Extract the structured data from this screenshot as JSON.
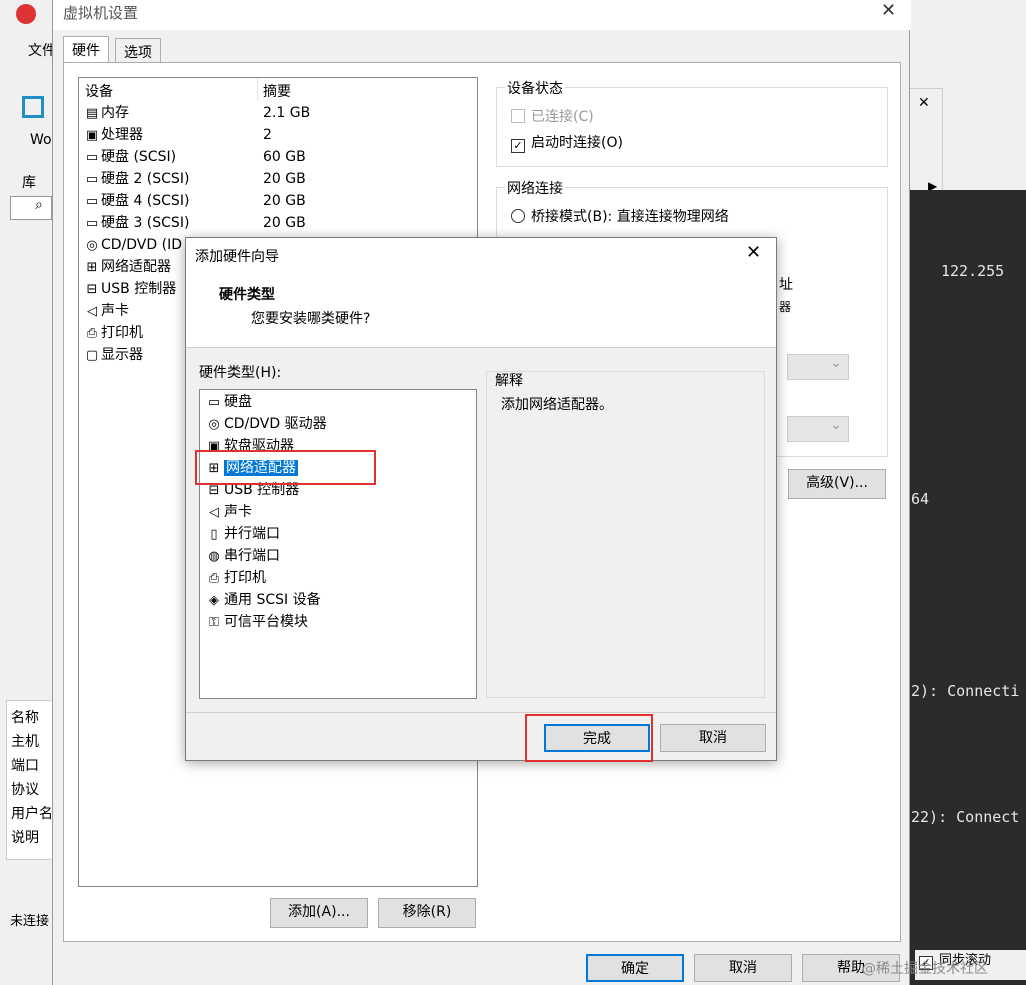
{
  "background": {
    "left_menu": [
      "文件",
      "库",
      "Wo"
    ],
    "left_fields": [
      "名称",
      "主机",
      "端口",
      "协议",
      "用户名",
      "说明"
    ],
    "status": "未连接",
    "terminal_lines": [
      "122.255",
      "64",
      "2): Connecti",
      "22): Connect"
    ],
    "sync_scroll": "同步滚动",
    "watermark": "@稀土掘金技术社区"
  },
  "settings": {
    "title": "虚拟机设置",
    "tabs": [
      "硬件",
      "选项"
    ],
    "columns": {
      "device": "设备",
      "summary": "摘要"
    },
    "devices": [
      {
        "icon": "memory-icon",
        "glyph": "▤",
        "name": "内存",
        "summary": "2.1 GB"
      },
      {
        "icon": "cpu-icon",
        "glyph": "▣",
        "name": "处理器",
        "summary": "2"
      },
      {
        "icon": "disk-icon",
        "glyph": "▭",
        "name": "硬盘 (SCSI)",
        "summary": "60 GB"
      },
      {
        "icon": "disk-icon",
        "glyph": "▭",
        "name": "硬盘 2 (SCSI)",
        "summary": "20 GB"
      },
      {
        "icon": "disk-icon",
        "glyph": "▭",
        "name": "硬盘 4 (SCSI)",
        "summary": "20 GB"
      },
      {
        "icon": "disk-icon",
        "glyph": "▭",
        "name": "硬盘 3 (SCSI)",
        "summary": "20 GB"
      },
      {
        "icon": "cd-icon",
        "glyph": "◎",
        "name": "CD/DVD (ID",
        "summary": ""
      },
      {
        "icon": "network-icon",
        "glyph": "⊞",
        "name": "网络适配器",
        "summary": ""
      },
      {
        "icon": "usb-icon",
        "glyph": "⊟",
        "name": "USB 控制器",
        "summary": ""
      },
      {
        "icon": "sound-icon",
        "glyph": "◁",
        "name": "声卡",
        "summary": ""
      },
      {
        "icon": "printer-icon",
        "glyph": "⎙",
        "name": "打印机",
        "summary": ""
      },
      {
        "icon": "display-icon",
        "glyph": "▢",
        "name": "显示器",
        "summary": ""
      }
    ],
    "add_button": "添加(A)...",
    "remove_button": "移除(R)",
    "device_status": {
      "title": "设备状态",
      "connected": "已连接(C)",
      "connect_on_start": "启动时连接(O)"
    },
    "network": {
      "title": "网络连接",
      "bridge": "桥接模式(B): 直接连接物理网络",
      "partial1": "址",
      "partial2": "器"
    },
    "advanced_button": "高级(V)...",
    "ok_button": "确定",
    "cancel_button": "取消",
    "help_button": "帮助"
  },
  "wizard": {
    "title": "添加硬件向导",
    "heading": "硬件类型",
    "subheading": "您要安装哪类硬件?",
    "list_label": "硬件类型(H):",
    "items": [
      {
        "icon": "disk-icon",
        "glyph": "▭",
        "label": "硬盘"
      },
      {
        "icon": "cd-icon",
        "glyph": "◎",
        "label": "CD/DVD 驱动器"
      },
      {
        "icon": "floppy-icon",
        "glyph": "▣",
        "label": "软盘驱动器"
      },
      {
        "icon": "network-icon",
        "glyph": "⊞",
        "label": "网络适配器",
        "selected": true
      },
      {
        "icon": "usb-icon",
        "glyph": "⊟",
        "label": "USB 控制器"
      },
      {
        "icon": "sound-icon",
        "glyph": "◁",
        "label": "声卡"
      },
      {
        "icon": "parallel-port-icon",
        "glyph": "▯",
        "label": "并行端口"
      },
      {
        "icon": "serial-port-icon",
        "glyph": "◍",
        "label": "串行端口"
      },
      {
        "icon": "printer-icon",
        "glyph": "⎙",
        "label": "打印机"
      },
      {
        "icon": "scsi-icon",
        "glyph": "◈",
        "label": "通用 SCSI 设备"
      },
      {
        "icon": "tpm-icon",
        "glyph": "⚿",
        "label": "可信平台模块"
      }
    ],
    "explain_label": "解释",
    "explain_text": "添加网络适配器。",
    "finish_button": "完成",
    "cancel_button": "取消"
  },
  "colors": {
    "highlight": "#0078d7",
    "annotation": "#e03030"
  }
}
